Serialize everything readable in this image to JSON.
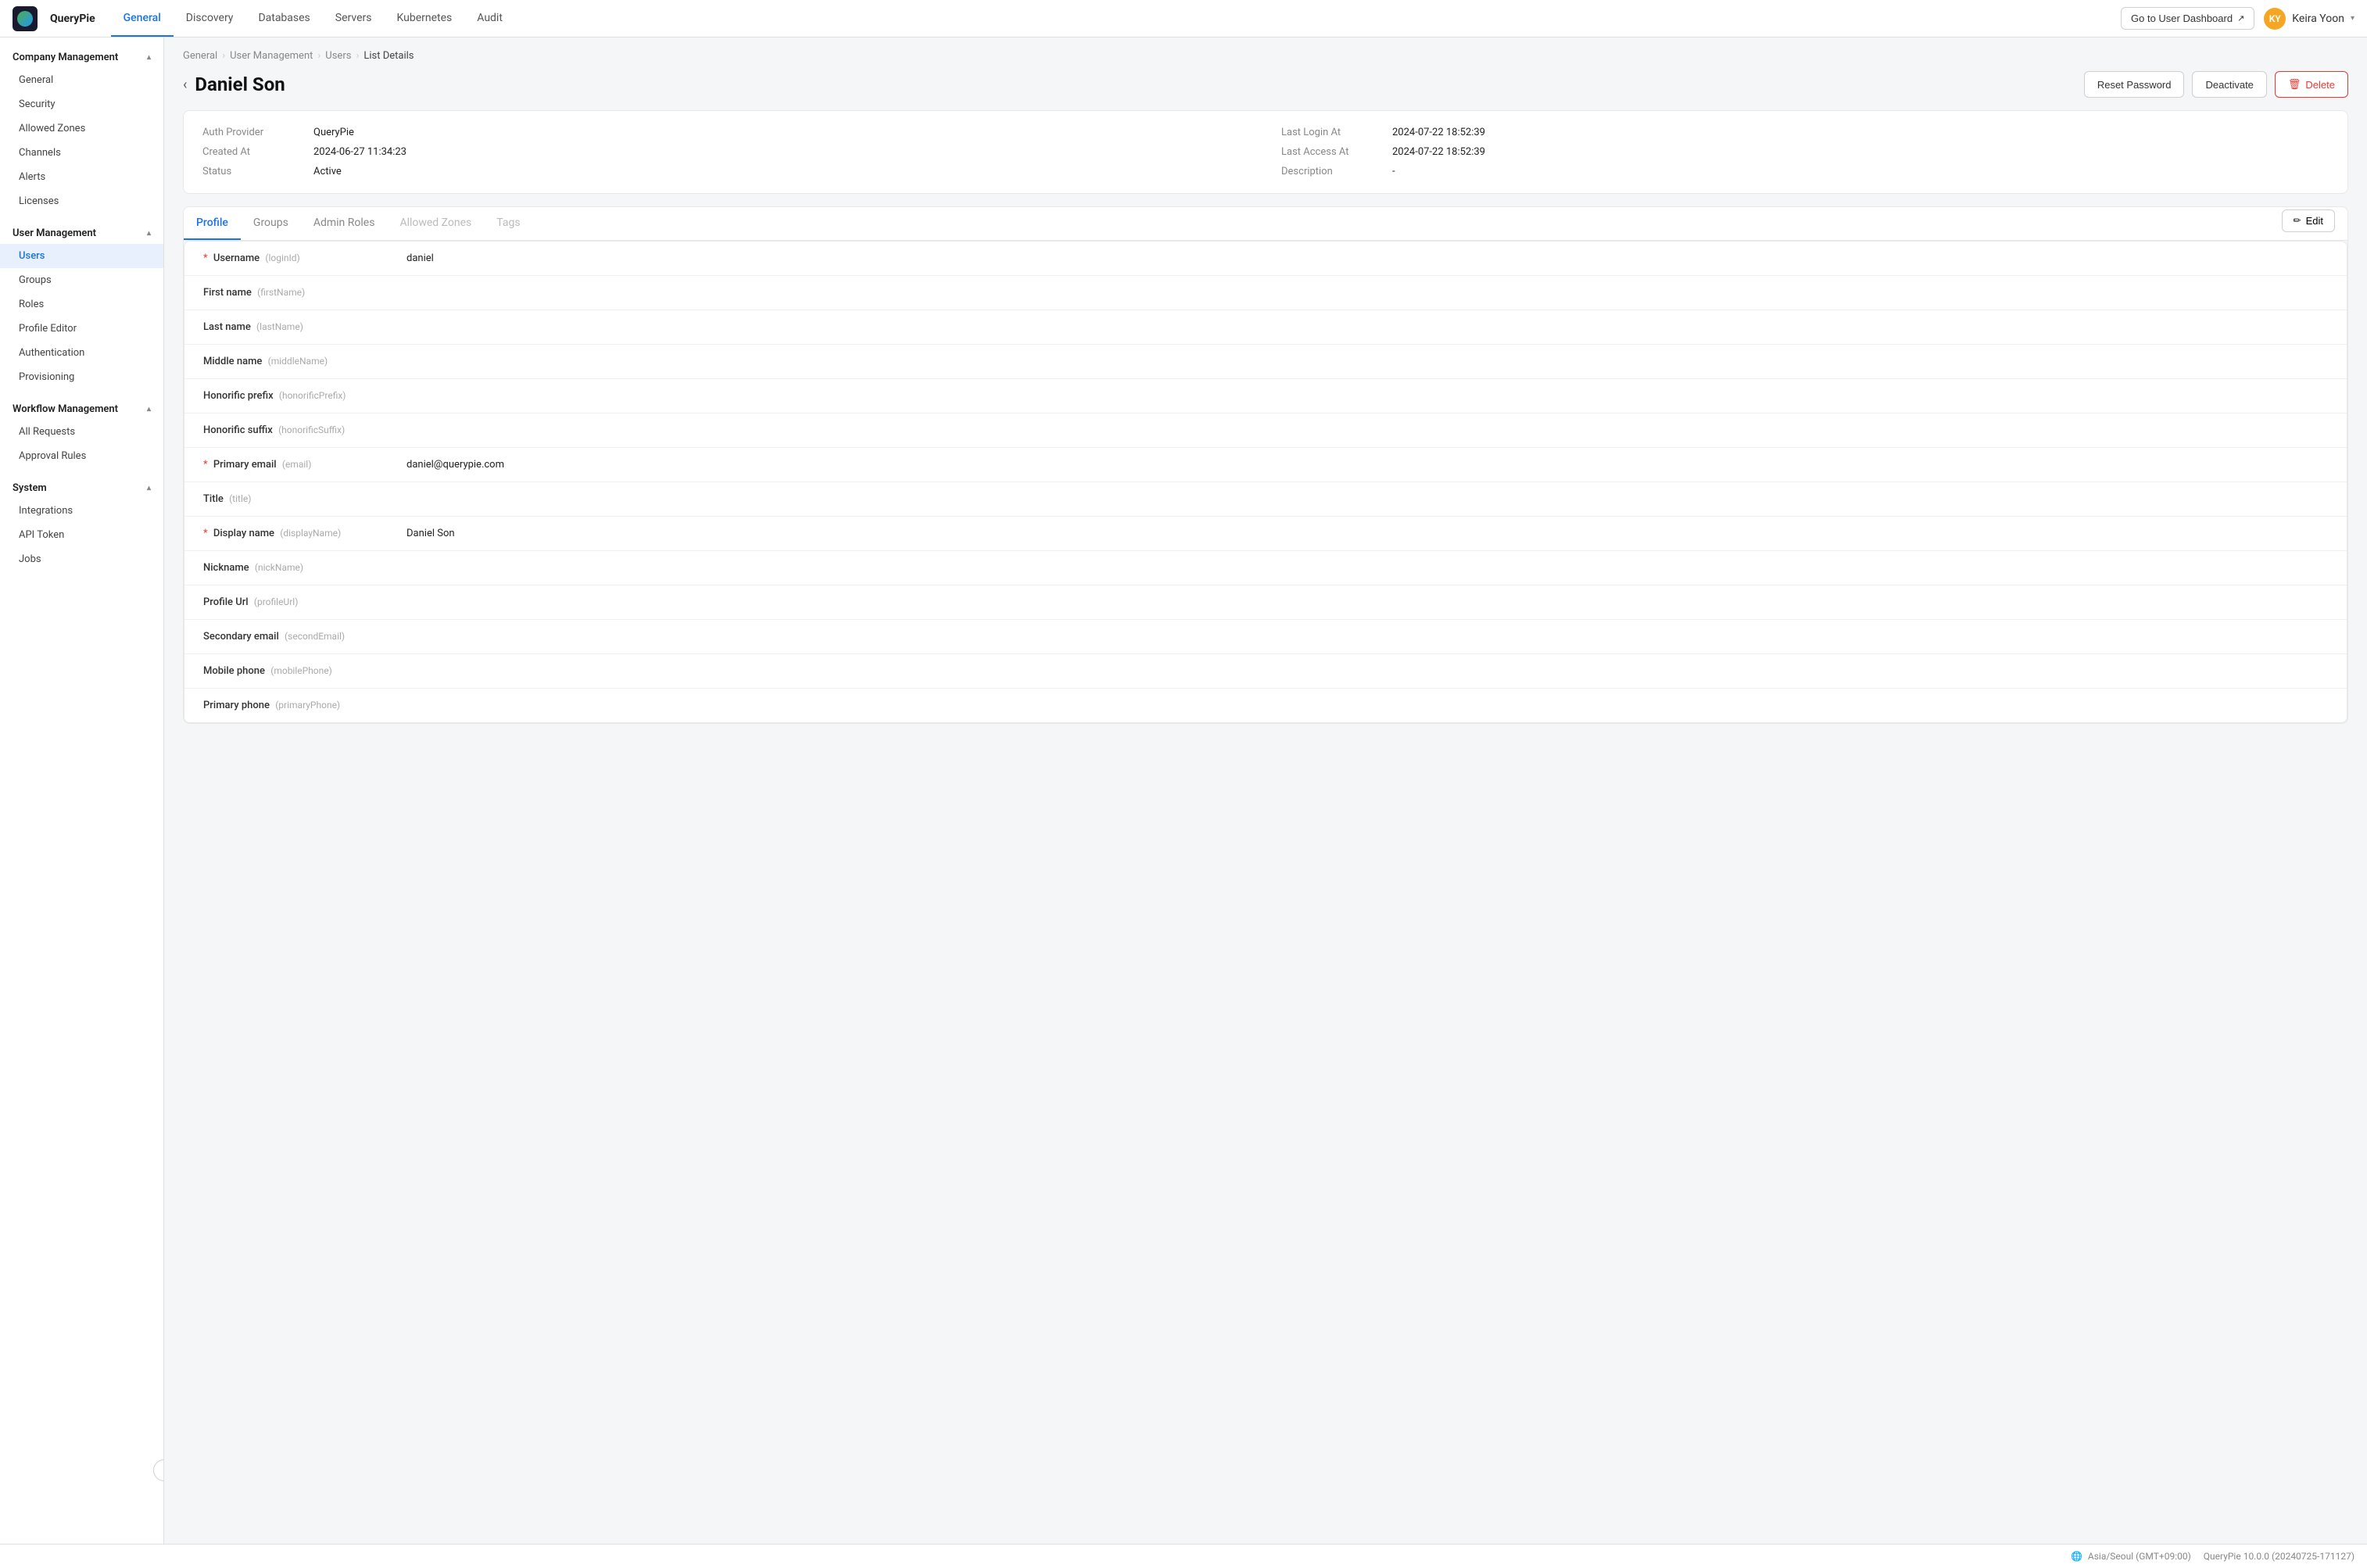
{
  "app": {
    "logo_text": "Q"
  },
  "top_nav": {
    "brand": "QueryPie",
    "tabs": [
      {
        "label": "General",
        "active": true
      },
      {
        "label": "Discovery",
        "active": false
      },
      {
        "label": "Databases",
        "active": false
      },
      {
        "label": "Servers",
        "active": false
      },
      {
        "label": "Kubernetes",
        "active": false
      },
      {
        "label": "Audit",
        "active": false
      }
    ],
    "user_dashboard_btn": "Go to User Dashboard",
    "user_name": "Keira Yoon",
    "user_initials": "KY"
  },
  "sidebar": {
    "company_management": {
      "header": "Company Management",
      "items": [
        {
          "label": "General",
          "active": false
        },
        {
          "label": "Security",
          "active": false
        },
        {
          "label": "Allowed Zones",
          "active": false
        },
        {
          "label": "Channels",
          "active": false
        },
        {
          "label": "Alerts",
          "active": false
        },
        {
          "label": "Licenses",
          "active": false
        }
      ]
    },
    "user_management": {
      "header": "User Management",
      "items": [
        {
          "label": "Users",
          "active": true
        },
        {
          "label": "Groups",
          "active": false
        },
        {
          "label": "Roles",
          "active": false
        },
        {
          "label": "Profile Editor",
          "active": false
        },
        {
          "label": "Authentication",
          "active": false
        },
        {
          "label": "Provisioning",
          "active": false
        }
      ]
    },
    "workflow_management": {
      "header": "Workflow Management",
      "items": [
        {
          "label": "All Requests",
          "active": false
        },
        {
          "label": "Approval Rules",
          "active": false
        }
      ]
    },
    "system": {
      "header": "System",
      "items": [
        {
          "label": "Integrations",
          "active": false
        },
        {
          "label": "API Token",
          "active": false
        },
        {
          "label": "Jobs",
          "active": false
        }
      ]
    }
  },
  "breadcrumb": {
    "items": [
      "General",
      "User Management",
      "Users",
      "List Details"
    ]
  },
  "page": {
    "title": "Daniel Son",
    "actions": {
      "reset_password": "Reset Password",
      "deactivate": "Deactivate",
      "delete": "Delete"
    }
  },
  "info_card": {
    "auth_provider_label": "Auth Provider",
    "auth_provider_value": "QueryPie",
    "last_login_at_label": "Last Login At",
    "last_login_at_value": "2024-07-22 18:52:39",
    "created_at_label": "Created At",
    "created_at_value": "2024-06-27 11:34:23",
    "last_access_at_label": "Last Access At",
    "last_access_at_value": "2024-07-22 18:52:39",
    "status_label": "Status",
    "status_value": "Active",
    "description_label": "Description",
    "description_value": "-"
  },
  "tabs": {
    "items": [
      {
        "label": "Profile",
        "active": true,
        "disabled": false
      },
      {
        "label": "Groups",
        "active": false,
        "disabled": false
      },
      {
        "label": "Admin Roles",
        "active": false,
        "disabled": false
      },
      {
        "label": "Allowed Zones",
        "active": false,
        "disabled": true
      },
      {
        "label": "Tags",
        "active": false,
        "disabled": true
      }
    ],
    "edit_btn": "Edit"
  },
  "profile_fields": [
    {
      "required": true,
      "name": "Username",
      "code": "(loginId)",
      "value": "daniel"
    },
    {
      "required": false,
      "name": "First name",
      "code": "(firstName)",
      "value": ""
    },
    {
      "required": false,
      "name": "Last name",
      "code": "(lastName)",
      "value": ""
    },
    {
      "required": false,
      "name": "Middle name",
      "code": "(middleName)",
      "value": ""
    },
    {
      "required": false,
      "name": "Honorific prefix",
      "code": "(honorificPrefix)",
      "value": ""
    },
    {
      "required": false,
      "name": "Honorific suffix",
      "code": "(honorificSuffix)",
      "value": ""
    },
    {
      "required": true,
      "name": "Primary email",
      "code": "(email)",
      "value": "daniel@querypie.com"
    },
    {
      "required": false,
      "name": "Title",
      "code": "(title)",
      "value": ""
    },
    {
      "required": true,
      "name": "Display name",
      "code": "(displayName)",
      "value": "Daniel Son"
    },
    {
      "required": false,
      "name": "Nickname",
      "code": "(nickName)",
      "value": ""
    },
    {
      "required": false,
      "name": "Profile Url",
      "code": "(profileUrl)",
      "value": ""
    },
    {
      "required": false,
      "name": "Secondary email",
      "code": "(secondEmail)",
      "value": ""
    },
    {
      "required": false,
      "name": "Mobile phone",
      "code": "(mobilePhone)",
      "value": ""
    },
    {
      "required": false,
      "name": "Primary phone",
      "code": "(primaryPhone)",
      "value": ""
    }
  ],
  "footer": {
    "timezone": "Asia/Seoul (GMT+09:00)",
    "version": "QueryPie 10.0.0 (20240725-171127)"
  }
}
